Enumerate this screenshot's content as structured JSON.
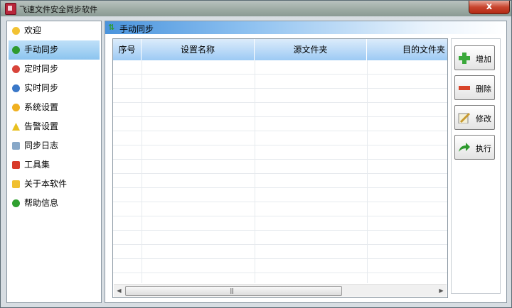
{
  "window": {
    "title": "飞速文件安全同步软件",
    "close_label": "x"
  },
  "sidebar": {
    "items": [
      {
        "label": "欢迎",
        "icon": "smiley-icon",
        "color": "#f2c233",
        "selected": false
      },
      {
        "label": "手动同步",
        "icon": "sync-arrows-icon",
        "color": "#2e9a2e",
        "selected": true
      },
      {
        "label": "定时同步",
        "icon": "clock-icon",
        "color": "#d8443a",
        "selected": false
      },
      {
        "label": "实时同步",
        "icon": "realtime-icon",
        "color": "#3a78c8",
        "selected": false
      },
      {
        "label": "系统设置",
        "icon": "gear-icon",
        "color": "#f0b020",
        "selected": false
      },
      {
        "label": "告警设置",
        "icon": "warning-icon",
        "color": "#e8c020",
        "selected": false
      },
      {
        "label": "同步日志",
        "icon": "log-icon",
        "color": "#88a8c8",
        "selected": false
      },
      {
        "label": "工具集",
        "icon": "toolbox-icon",
        "color": "#d83a2a",
        "selected": false
      },
      {
        "label": "关于本软件",
        "icon": "folder-info-icon",
        "color": "#f0c030",
        "selected": false
      },
      {
        "label": "帮助信息",
        "icon": "help-icon",
        "color": "#30a030",
        "selected": false
      }
    ]
  },
  "main": {
    "section_title": "手动同步",
    "table": {
      "columns": [
        "序号",
        "设置名称",
        "源文件夹",
        "目的文件夹"
      ],
      "rows": []
    },
    "scrollbar_grip": "|||",
    "actions": [
      {
        "label": "增加",
        "icon": "add-icon",
        "color": "#3aa83a"
      },
      {
        "label": "删除",
        "icon": "remove-icon",
        "color": "#d8442a"
      },
      {
        "label": "修改",
        "icon": "edit-icon",
        "color": "#c89a30"
      },
      {
        "label": "执行",
        "icon": "execute-arrow-icon",
        "color": "#2e9a2e"
      }
    ]
  }
}
